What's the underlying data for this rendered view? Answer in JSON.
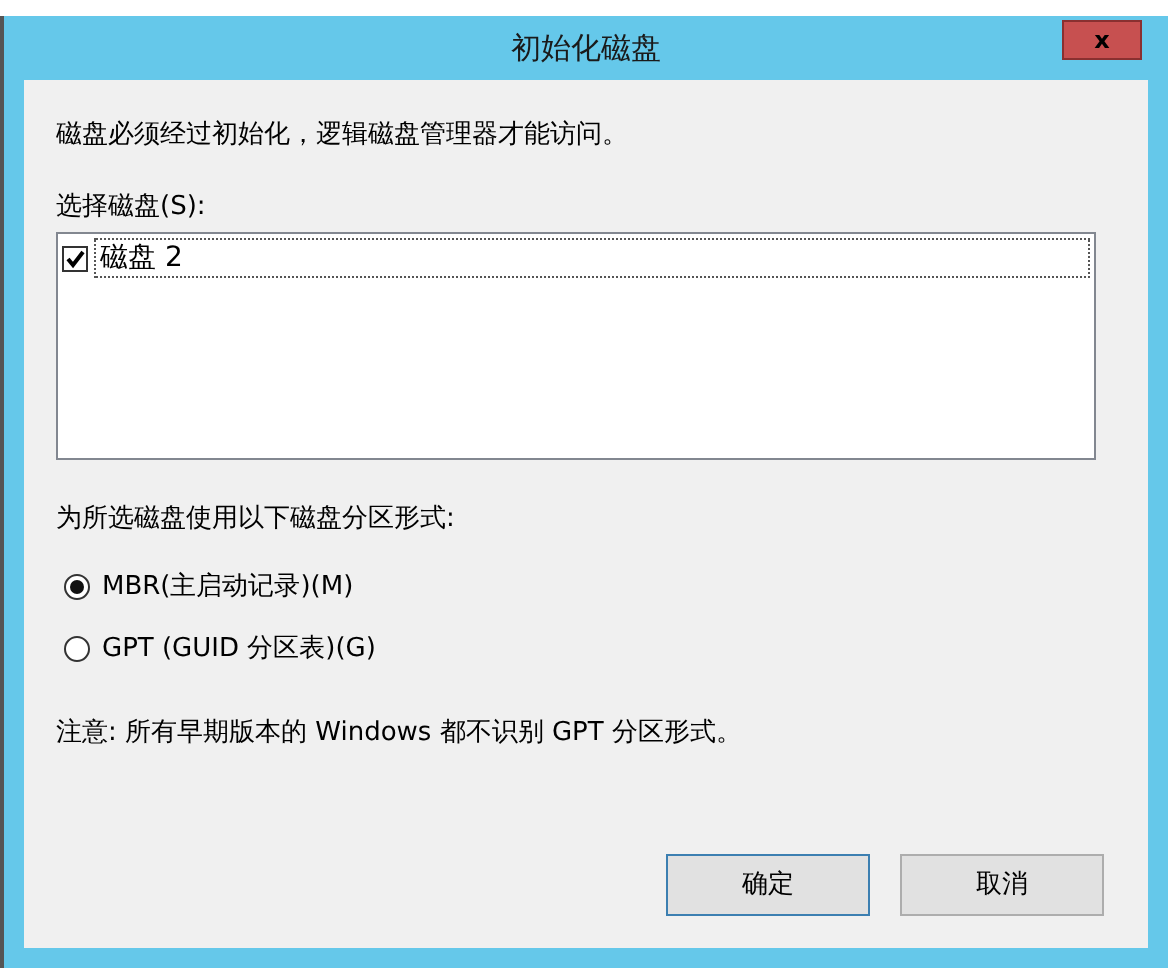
{
  "window": {
    "title": "初始化磁盘",
    "close": "x"
  },
  "message": "磁盘必须经过初始化，逻辑磁盘管理器才能访问。",
  "disk_list": {
    "label": "选择磁盘(S):",
    "items": [
      {
        "label": "磁盘 2",
        "checked": true
      }
    ]
  },
  "partition_style": {
    "label": "为所选磁盘使用以下磁盘分区形式:",
    "options": [
      {
        "label": "MBR(主启动记录)(M)",
        "selected": true
      },
      {
        "label": "GPT (GUID 分区表)(G)",
        "selected": false
      }
    ]
  },
  "note": "注意: 所有早期版本的 Windows 都不识别 GPT 分区形式。",
  "buttons": [
    "确定",
    "取消"
  ]
}
